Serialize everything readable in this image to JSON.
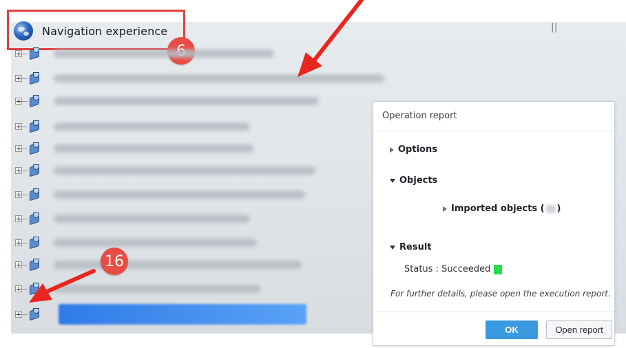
{
  "tree": {
    "root_label": "Navigation experience",
    "root_icon": "globe-icon",
    "item_icon": "part-icon",
    "expander_icon": "plus-expander-icon",
    "item_count": 13
  },
  "annotations": {
    "badge_6": "6",
    "badge_16": "16",
    "accent_color": "#e84c43",
    "separator": "||"
  },
  "dialog": {
    "title": "Operation report",
    "options_label": "Options",
    "objects_label": "Objects",
    "imported_objects_prefix": "Imported objects (",
    "imported_objects_suffix": ")",
    "result_label": "Result",
    "status_text": "Status : Succeeded",
    "status_color": "#22e04a",
    "note": "For further details, please open the execution report.",
    "ok_label": "OK",
    "open_report_label": "Open report",
    "ok_color": "#3a9ae0"
  }
}
